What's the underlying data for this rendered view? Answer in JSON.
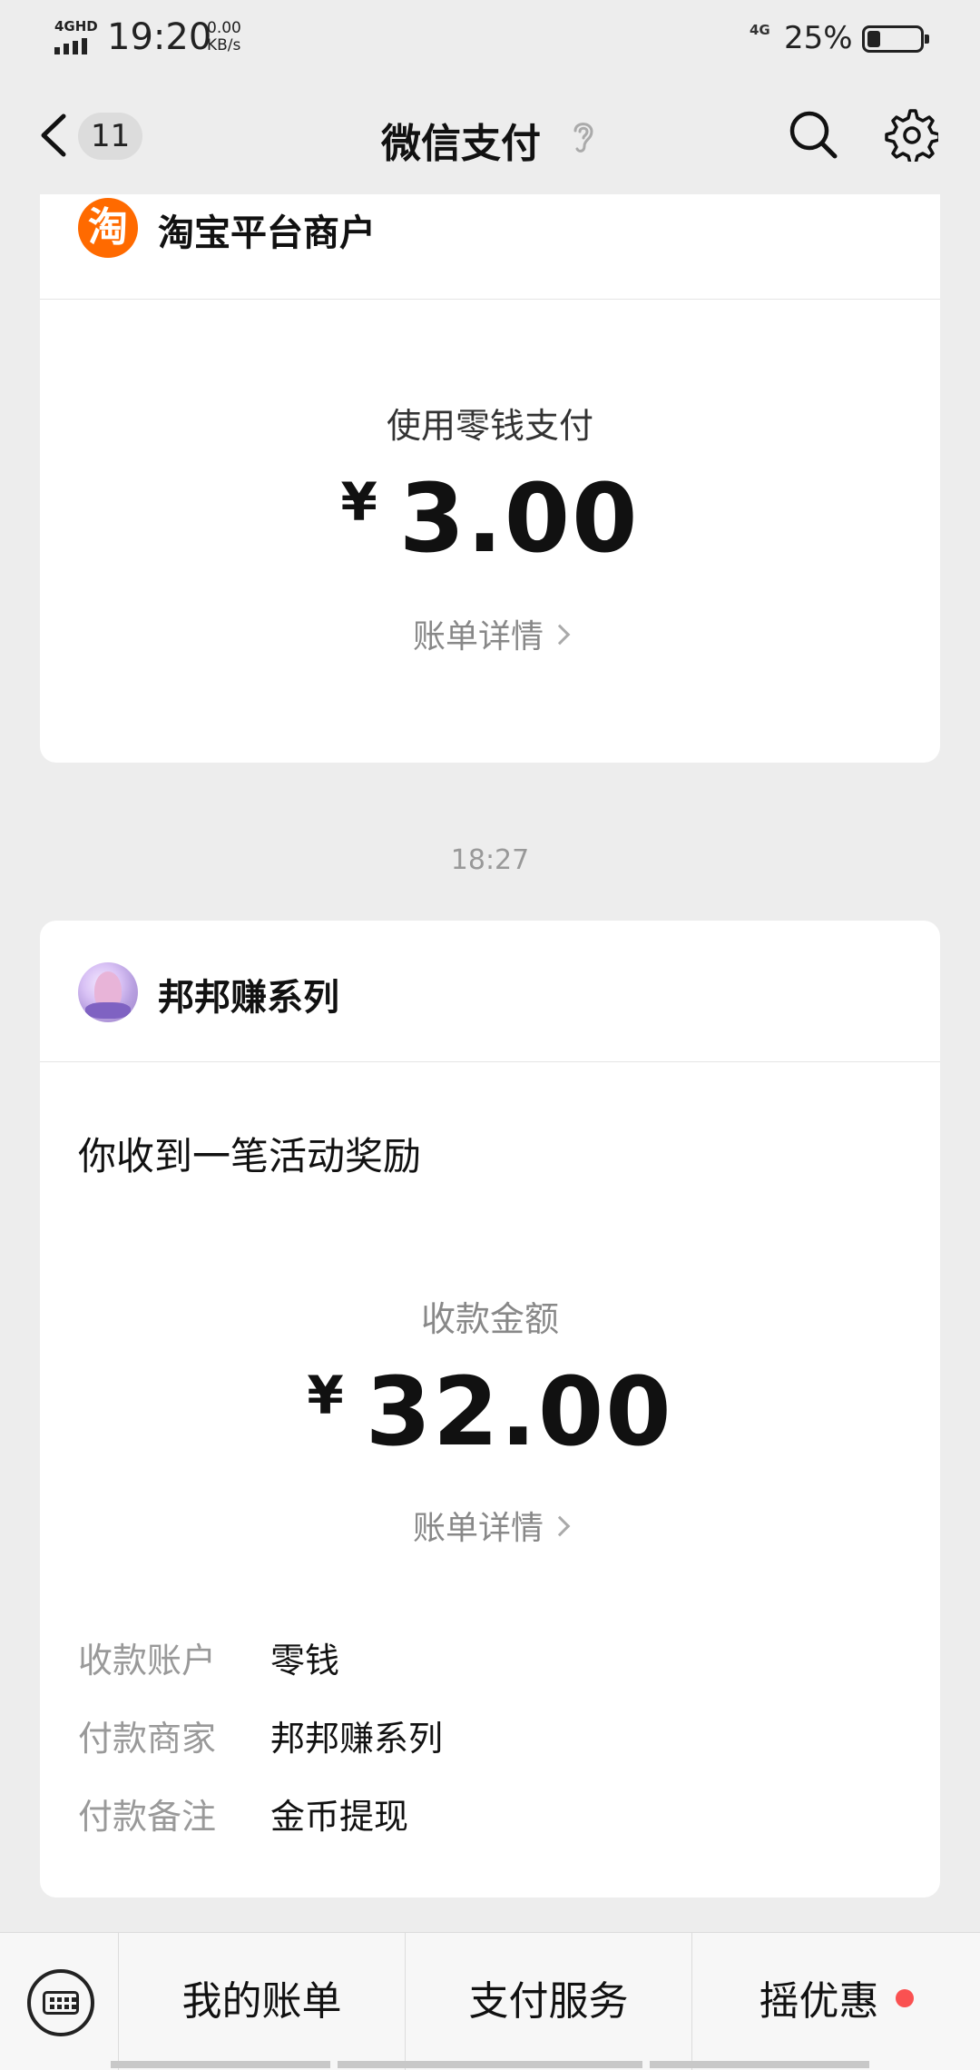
{
  "status_bar": {
    "network_label": "4GHD",
    "time": "19:20",
    "speed_value": "0.00",
    "speed_unit": "KB/s",
    "network_4g": "4G",
    "battery_percent": "25%",
    "battery_level": 0.25
  },
  "nav": {
    "unread_count": "11",
    "title": "微信支付",
    "icons": [
      "back-chevron-icon",
      "ear-icon",
      "search-icon",
      "gear-icon"
    ]
  },
  "card1": {
    "merchant_name": "淘宝平台商户",
    "merchant_logo_text": "淘",
    "pay_method": "使用零钱支付",
    "currency": "¥",
    "amount": "3.00",
    "bill_link": "账单详情"
  },
  "time_separator": "18:27",
  "card2": {
    "merchant_name": "邦邦赚系列",
    "title": "你收到一笔活动奖励",
    "amount_label": "收款金额",
    "currency": "¥",
    "amount": "32.00",
    "bill_link": "账单详情",
    "details": [
      {
        "key": "收款账户",
        "value": "零钱"
      },
      {
        "key": "付款商家",
        "value": "邦邦赚系列"
      },
      {
        "key": "付款备注",
        "value": "金币提现"
      }
    ]
  },
  "bottom_menu": {
    "items": [
      "我的账单",
      "支付服务",
      "摇优惠"
    ],
    "accent_color": "#fa5151"
  }
}
